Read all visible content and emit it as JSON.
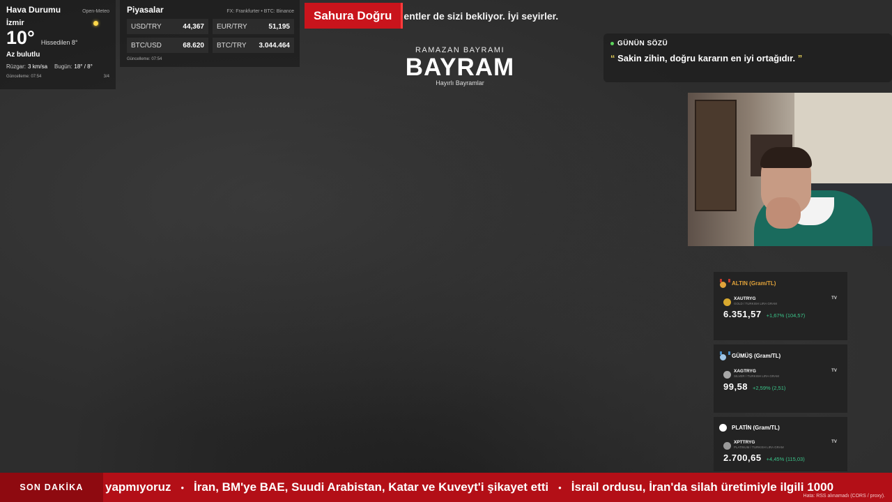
{
  "weather": {
    "title": "Hava Durumu",
    "source": "Open-Meteo",
    "city": "İzmir",
    "icon": "partly-cloudy-sun-icon",
    "temperature": "10°",
    "feels_like": "Hissedilen 8°",
    "condition": "Az bulutlu",
    "wind_label": "Rüzgar:",
    "wind_value": "3 km/sa",
    "today_label": "Bugün:",
    "today_value": "18° / 8°",
    "updated": "Güncelleme: 07:54",
    "page": "3/4"
  },
  "markets": {
    "title": "Piyasalar",
    "source": "FX: Frankfurter • BTC: Binance",
    "rates": [
      {
        "symbol": "USD/TRY",
        "value": "44,367"
      },
      {
        "symbol": "EUR/TRY",
        "value": "51,195"
      },
      {
        "symbol": "BTC/USD",
        "value": "68.620"
      },
      {
        "symbol": "BTC/TRY",
        "value": "3.044.464"
      }
    ],
    "updated": "Güncelleme: 07:54"
  },
  "headline": {
    "badge": "Sahura Doğru",
    "text": "entler de sizi bekliyor. İyi seyirler."
  },
  "center": {
    "supertitle": "RAMAZAN BAYRAMI",
    "title": "BAYRAM",
    "subtitle": "Hayırlı Bayramlar"
  },
  "quote": {
    "label": "GÜNÜN SÖZÜ",
    "open_mark": "“",
    "text": "Sakin zihin, doğru kararın en iyi ortağıdır.",
    "close_mark": "”"
  },
  "metals": [
    {
      "title": "ALTIN (Gram/TL)",
      "symbol": "XAUTRYG",
      "desc": "GOLD / TURKISH LIRA GRAM",
      "price": "6.351,57",
      "change": "+1,67% (104,57)",
      "color": "#e2a33a",
      "coin": "#d8a92f",
      "icon": "gold-medal-icon"
    },
    {
      "title": "GÜMÜŞ (Gram/TL)",
      "symbol": "XAGTRYG",
      "desc": "SILVER / TURKISH LIRA GRAM",
      "price": "99,58",
      "change": "+2,59% (2,51)",
      "color": "#9fc6e8",
      "coin": "#a8a8a8",
      "icon": "silver-medal-icon"
    },
    {
      "title": "PLATİN (Gram/TL)",
      "symbol": "XPTTRYG",
      "desc": "PLATINUM / TURKISH LIRA GRAM",
      "price": "2.700,65",
      "change": "+4,45% (115,03)",
      "color": "#ffffff",
      "coin": "#9a9a9a",
      "icon": "platinum-circle-icon"
    }
  ],
  "tradingview_logo": "TV",
  "ticker": {
    "label": "SON DAKİKA",
    "items": [
      "yapmıyoruz",
      "İran, BM'ye BAE, Suudi Arabistan, Katar ve Kuveyt'i şikayet etti",
      "İsrail ordusu, İran'da silah üretimiyle ilgili 1000"
    ],
    "separator": "•",
    "error": "Hata: RSS alınamadı (CORS / proxy)."
  }
}
